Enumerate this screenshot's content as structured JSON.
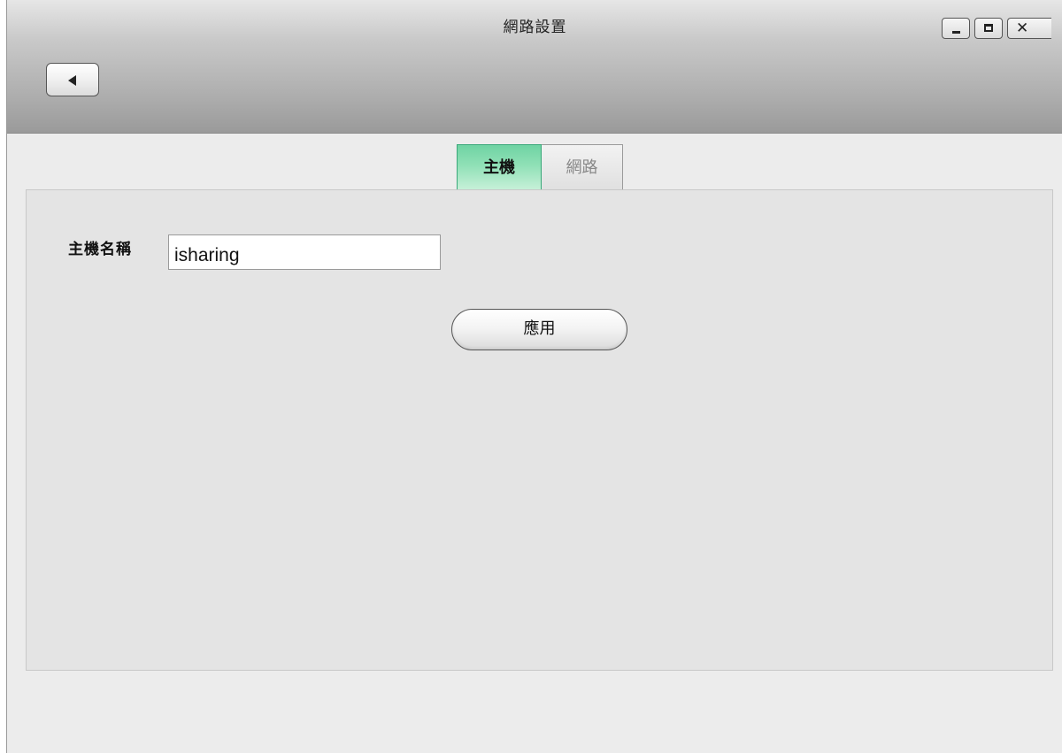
{
  "window": {
    "title": "網路設置"
  },
  "titlebar": {
    "back_icon": "left-triangle-icon",
    "controls": {
      "minimize_icon": "minimize-icon",
      "maximize_icon": "maximize-icon",
      "close_icon": "close-icon"
    }
  },
  "tabs": [
    {
      "label": "主機",
      "active": true
    },
    {
      "label": "網路",
      "active": false
    }
  ],
  "host_form": {
    "label": "主機名稱",
    "value": "isharing",
    "apply_label": "應用"
  },
  "colors": {
    "active_tab": "#8fe0b6",
    "panel_bg": "#e4e4e4"
  }
}
